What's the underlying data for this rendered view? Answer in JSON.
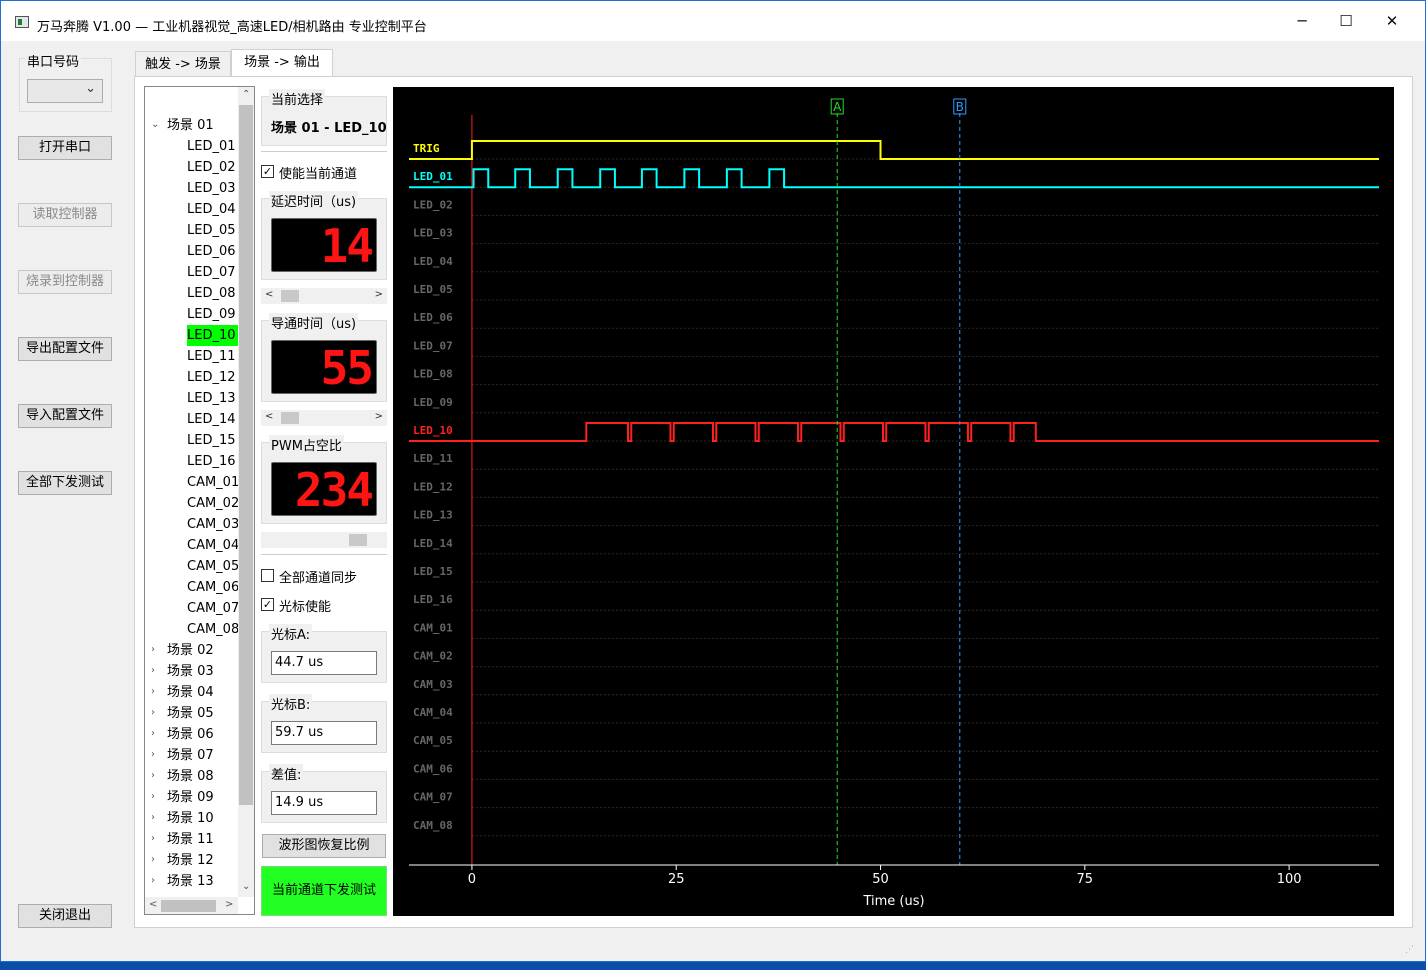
{
  "window": {
    "title": "万马奔腾 V1.00 — 工业机器视觉_高速LED/相机路由 专业控制平台",
    "minimize": "─",
    "maximize": "☐",
    "close": "✕"
  },
  "left_panel": {
    "port_group_label": "串口号码",
    "port_select_value": "",
    "buttons": {
      "open_port": "打开串口",
      "read_controller": "读取控制器",
      "burn_controller": "烧录到控制器",
      "export_config": "导出配置文件",
      "import_config": "导入配置文件",
      "send_all_test": "全部下发测试",
      "close_exit": "关闭退出"
    }
  },
  "tabs": [
    {
      "label": "触发 -> 场景"
    },
    {
      "label": "场景 -> 输出"
    }
  ],
  "tree": {
    "root": "场景 01",
    "children": [
      "LED_01",
      "LED_02",
      "LED_03",
      "LED_04",
      "LED_05",
      "LED_06",
      "LED_07",
      "LED_08",
      "LED_09",
      "LED_10",
      "LED_11",
      "LED_12",
      "LED_13",
      "LED_14",
      "LED_15",
      "LED_16",
      "CAM_01",
      "CAM_02",
      "CAM_03",
      "CAM_04",
      "CAM_05",
      "CAM_06",
      "CAM_07",
      "CAM_08"
    ],
    "selected": "LED_10",
    "collapsed": [
      "场景 02",
      "场景 03",
      "场景 04",
      "场景 05",
      "场景 06",
      "场景 07",
      "场景 08",
      "场景 09",
      "场景 10",
      "场景 11",
      "场景 12",
      "场景 13"
    ]
  },
  "settings": {
    "current_selection_label": "当前选择",
    "current_selection_value": "场景 01 - LED_10",
    "enable_channel_label": "使能当前通道",
    "enable_channel_checked": true,
    "delay_label": "延迟时间（us)",
    "delay_value": "14",
    "delay_slider": 0.07,
    "on_time_label": "导通时间（us)",
    "on_time_value": "55",
    "on_time_slider": 0.08,
    "pwm_label": "PWM占空比",
    "pwm_value": "234",
    "pwm_slider": 0.92,
    "sync_all_label": "全部通道同步",
    "sync_all_checked": false,
    "cursor_enable_label": "光标使能",
    "cursor_enable_checked": true,
    "cursor_a_label": "光标A:",
    "cursor_a_value": "44.7 us",
    "cursor_b_label": "光标B:",
    "cursor_b_value": "59.7 us",
    "diff_label": "差值:",
    "diff_value": "14.9 us",
    "restore_button": "波形图恢复比例",
    "send_current_button": "当前通道下发测试",
    "send_current_color": "#22ff22",
    "check_mark": "✓"
  },
  "chart_data": {
    "type": "line",
    "xlabel": "Time (us)",
    "xlim": [
      -7.7,
      111
    ],
    "xticks": [
      0,
      25,
      50,
      75,
      100
    ],
    "channels": [
      "TRIG",
      "LED_01",
      "LED_02",
      "LED_03",
      "LED_04",
      "LED_05",
      "LED_06",
      "LED_07",
      "LED_08",
      "LED_09",
      "LED_10",
      "LED_11",
      "LED_12",
      "LED_13",
      "LED_14",
      "LED_15",
      "LED_16",
      "CAM_01",
      "CAM_02",
      "CAM_03",
      "CAM_04",
      "CAM_05",
      "CAM_06",
      "CAM_07",
      "CAM_08"
    ],
    "active_channels": {
      "TRIG": "#ffff00",
      "LED_01": "#00ffff",
      "LED_10": "#ff2020"
    },
    "inactive_color": "#666666",
    "series": [
      {
        "name": "TRIG",
        "high_intervals": [
          [
            0,
            50
          ]
        ]
      },
      {
        "name": "LED_01",
        "high_intervals": [
          [
            0.2,
            2
          ],
          [
            5.3,
            7.1
          ],
          [
            10.5,
            12.3
          ],
          [
            15.7,
            17.5
          ],
          [
            20.8,
            22.6
          ],
          [
            26,
            27.8
          ],
          [
            31.2,
            33
          ],
          [
            36.4,
            38.2
          ]
        ]
      },
      {
        "name": "LED_10",
        "high_intervals": [
          [
            14,
            19.1
          ],
          [
            19.5,
            24.3
          ],
          [
            24.7,
            29.5
          ],
          [
            29.9,
            34.7
          ],
          [
            35.1,
            39.9
          ],
          [
            40.3,
            45.1
          ],
          [
            45.5,
            50.3
          ],
          [
            50.7,
            55.5
          ],
          [
            55.9,
            60.7
          ],
          [
            61.1,
            65.9
          ],
          [
            66.3,
            69
          ]
        ]
      }
    ],
    "cursors": [
      {
        "label": "A",
        "x": 44.7,
        "color": "#22dd22"
      },
      {
        "label": "B",
        "x": 59.7,
        "color": "#3399ff"
      }
    ],
    "trigger_line": {
      "x": 0,
      "color": "#ff2020"
    }
  }
}
